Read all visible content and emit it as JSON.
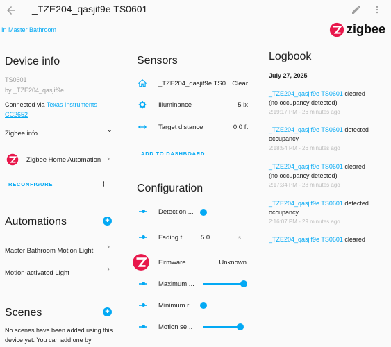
{
  "header": {
    "back_icon": "arrow-left-icon",
    "title": "_TZE204_qasjif9e TS0601",
    "edit_icon": "pencil-icon",
    "menu_icon": "more-vert-icon"
  },
  "area_link": "In Master Bathroom",
  "brand": {
    "logo_text": "zigbee",
    "color": "#e8174b"
  },
  "device_info": {
    "title": "Device info",
    "model": "TS0601",
    "manufacturer": "by _TZE204_qasjif9e",
    "connected_prefix": "Connected via ",
    "connected_link_1": "Texas Instruments",
    "connected_link_2": "CC2652",
    "zigbee_info_label": "Zigbee info",
    "integration_label": "Zigbee Home Automation",
    "reconfigure_label": "RECONFIGURE"
  },
  "automations": {
    "title": "Automations",
    "items": [
      "Master Bathroom Motion Light",
      "Motion-activated Light"
    ]
  },
  "scenes": {
    "title": "Scenes",
    "empty_line_1": "No scenes have been added using this",
    "empty_line_2": "device yet. You can add one by"
  },
  "sensors": {
    "title": "Sensors",
    "rows": [
      {
        "icon": "home-icon",
        "label": "_TZE204_qasjif9e TS0...",
        "value": "Clear"
      },
      {
        "icon": "brightness-icon",
        "label": "Illuminance",
        "value": "5 lx"
      },
      {
        "icon": "arrow-expand-horizontal-icon",
        "label": "Target distance",
        "value": "0.0 ft"
      }
    ],
    "add_label": "ADD TO DASHBOARD"
  },
  "configuration": {
    "title": "Configuration",
    "detection_label": "Detection ...",
    "detection_level": 0,
    "fading_label": "Fading ti...",
    "fading_value": "5.0",
    "fading_unit": "s",
    "firmware_label": "Firmware",
    "firmware_value": "Unknown",
    "maximum_label": "Maximum ...",
    "maximum_level": 1,
    "minimum_label": "Minimum r...",
    "minimum_level": 0,
    "motion_label": "Motion se...",
    "motion_level": 0.9
  },
  "logbook": {
    "title": "Logbook",
    "date": "July 27, 2025",
    "entries": [
      {
        "entity": "_TZE204_qasjif9e TS0601",
        "action": " cleared",
        "detail": "(no occupancy detected)",
        "time": "2:19:17 PM - 26 minutes ago"
      },
      {
        "entity": "_TZE204_qasjif9e TS0601",
        "action": " detected",
        "detail": "occupancy",
        "time": "2:18:54 PM - 26 minutes ago"
      },
      {
        "entity": "_TZE204_qasjif9e TS0601",
        "action": " cleared",
        "detail": "(no occupancy detected)",
        "time": "2:17:34 PM - 28 minutes ago"
      },
      {
        "entity": "_TZE204_qasjif9e TS0601",
        "action": " detected",
        "detail": "occupancy",
        "time": "2:16:07 PM - 29 minutes ago"
      },
      {
        "entity": "_TZE204_qasjif9e TS0601",
        "action": " cleared",
        "detail": "",
        "time": ""
      }
    ]
  }
}
